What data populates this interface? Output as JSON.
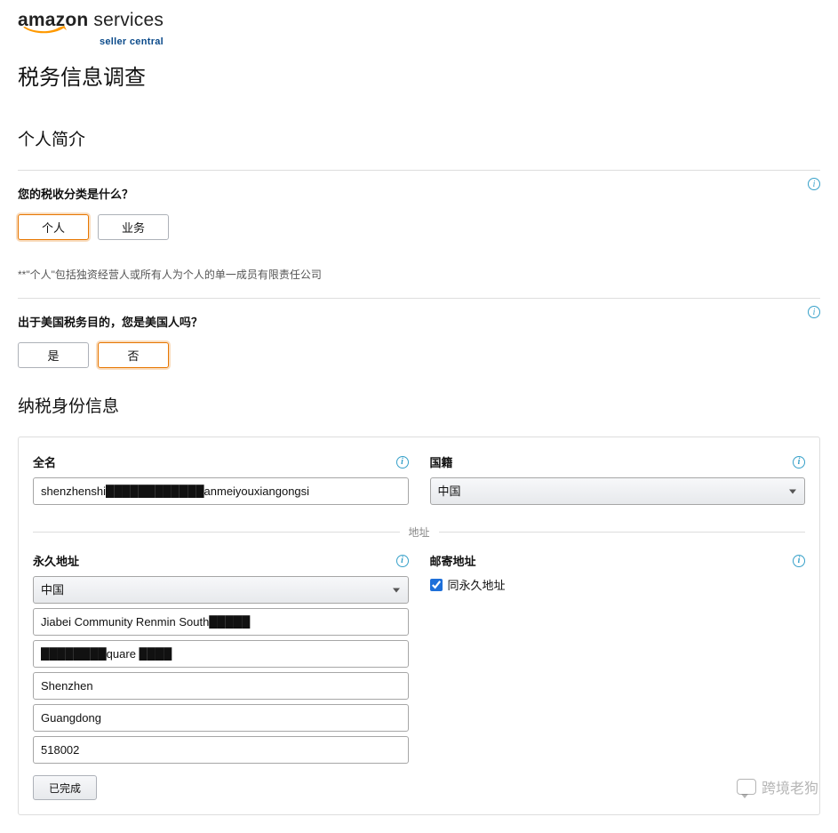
{
  "logo": {
    "main_bold": "amazon",
    "main_rest": " services",
    "sub": "seller central"
  },
  "page_title": "税务信息调查",
  "profile_heading": "个人简介",
  "q_classification": {
    "label": "您的税收分类是什么？",
    "options": {
      "individual": "个人",
      "business": "业务"
    },
    "note": "**\"个人\"包括独资经营人或所有人为个人的单一成员有限责任公司"
  },
  "q_usperson": {
    "label": "出于美国税务目的，您是美国人吗？",
    "options": {
      "yes": "是",
      "no": "否"
    }
  },
  "identity_heading": "纳税身份信息",
  "fullname": {
    "label": "全名",
    "value": "shenzhenshi████████████anmeiyouxiangongsi"
  },
  "nationality": {
    "label": "国籍",
    "value": "中国"
  },
  "address_divider": "地址",
  "perm_address": {
    "label": "永久地址",
    "country": "中国",
    "line1": "Jiabei Community Renmin South█████",
    "line2": "████████quare ████",
    "city": "Shenzhen",
    "state": "Guangdong",
    "postal": "518002"
  },
  "done_button": "已完成",
  "mailing_address": {
    "label": "邮寄地址",
    "same_as_perm": "同永久地址"
  },
  "watermark": "跨境老狗"
}
